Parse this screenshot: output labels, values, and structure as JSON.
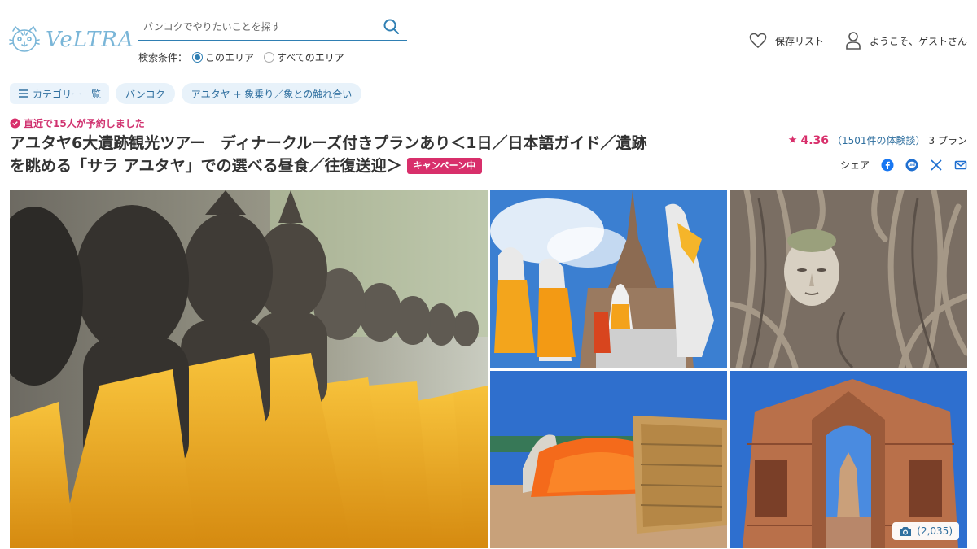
{
  "header": {
    "logo_text": "VeLTRA",
    "search": {
      "placeholder": "バンコクでやりたいことを探す",
      "value": ""
    },
    "filter": {
      "label": "検索条件：",
      "options": [
        {
          "label": "このエリア",
          "selected": true
        },
        {
          "label": "すべてのエリア",
          "selected": false
        }
      ]
    },
    "save_list": "保存リスト",
    "welcome": "ようこそ、ゲストさん"
  },
  "breadcrumb": {
    "category": "カテゴリー一覧",
    "items": [
      "バンコク",
      "アユタヤ + 象乗り／象との触れ合い"
    ]
  },
  "tour": {
    "recent_booked": "直近で15人が予約しました",
    "title": "アユタヤ6大遺跡観光ツアー　ディナークルーズ付きプランあり＜1日／日本語ガイド／遺跡を眺める「サラ アユタヤ」での選べる昼食／往復送迎＞",
    "campaign_badge": "キャンペーン中",
    "rating": "4.36",
    "review_count": "（1501件の体験談）",
    "plans": "3 プラン",
    "share_label": "シェア"
  },
  "gallery": {
    "photo_count": "(2,035)",
    "images": [
      "buddha-statues-row",
      "wat-yai-chai-mongkhon",
      "buddha-head-in-tree-roots",
      "reclining-buddha",
      "temple-ruin-doorway"
    ]
  },
  "colors": {
    "accent": "#2f7fb3",
    "brand_pink": "#d82f6b",
    "chip_bg": "#e8f2fa"
  }
}
